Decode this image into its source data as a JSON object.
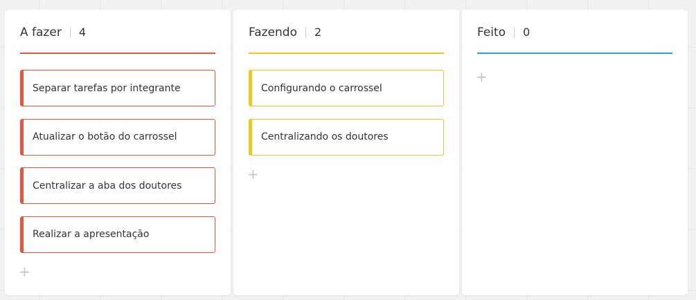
{
  "columns": [
    {
      "title": "A fazer",
      "count": "4",
      "accent": "#e8553e",
      "cards": [
        "Separar tarefas por integrante",
        "Atualizar o botão do carrossel",
        "Centralizar a aba dos doutores",
        "Realizar a apresentação"
      ],
      "add_icon": "+"
    },
    {
      "title": "Fazendo",
      "count": "2",
      "accent": "#f5c518",
      "cards": [
        "Configurando o carrossel",
        "Centralizando os doutores"
      ],
      "add_icon": "+"
    },
    {
      "title": "Feito",
      "count": "0",
      "accent": "#2d9ee0",
      "cards": [],
      "add_icon": "+"
    }
  ]
}
